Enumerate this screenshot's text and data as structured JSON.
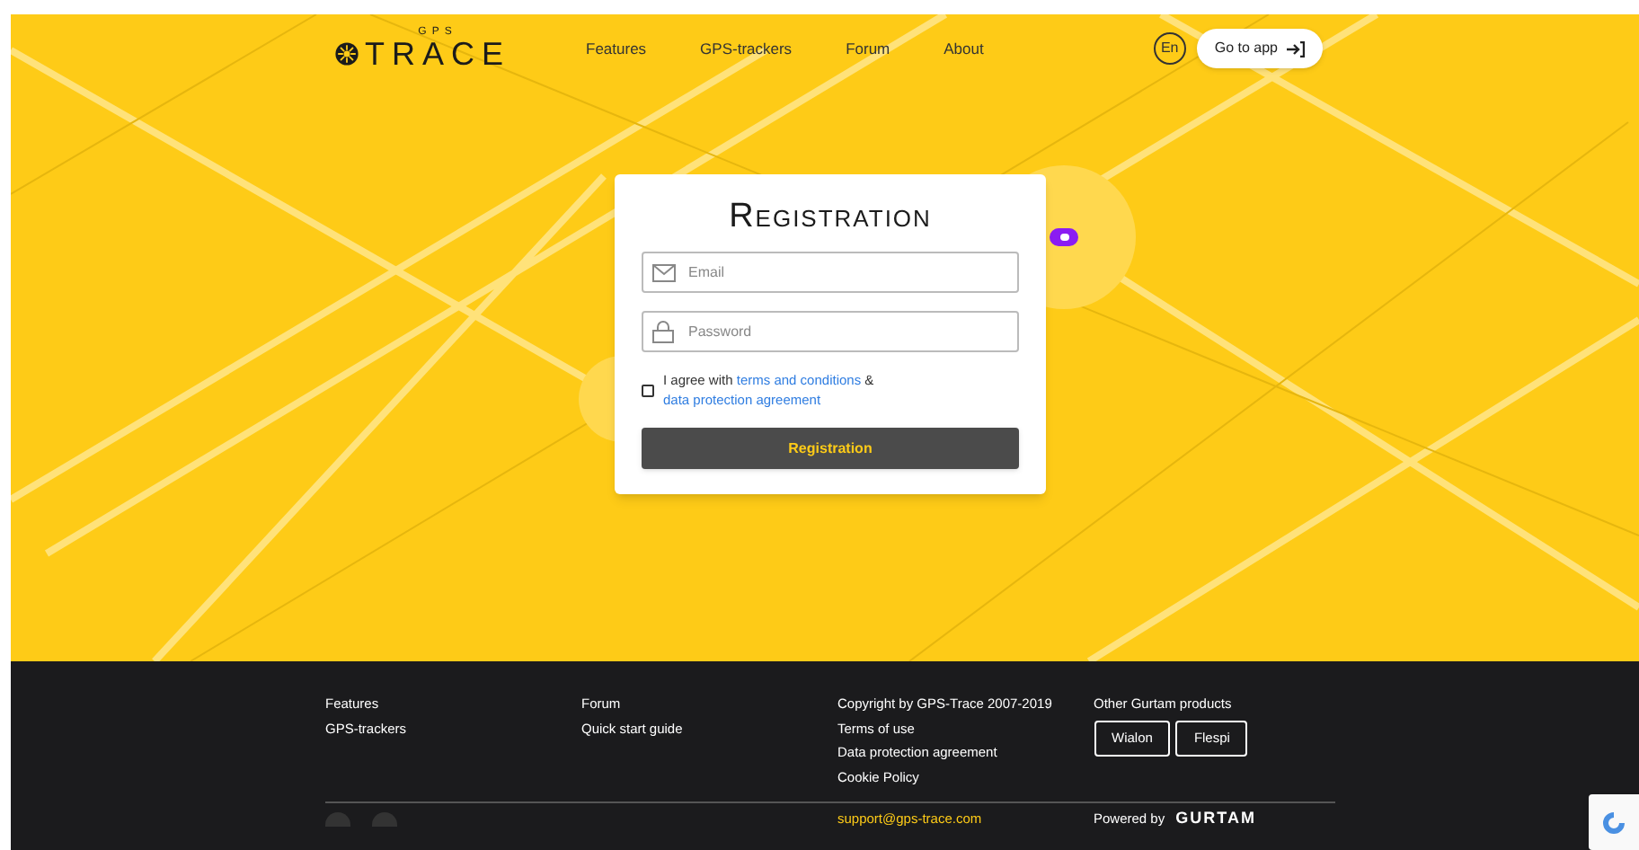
{
  "header": {
    "logo": {
      "top": "GPS",
      "main": "TRACE"
    },
    "nav": [
      "Features",
      "GPS-trackers",
      "Forum",
      "About"
    ],
    "language": "En",
    "app_button": "Go to app"
  },
  "registration": {
    "title": "Registration",
    "fields": [
      {
        "kind": "email",
        "placeholder": "Email"
      },
      {
        "kind": "password",
        "placeholder": "Password"
      }
    ],
    "agreement": {
      "checked": false,
      "prefix": "I agree with",
      "link_1": "terms and conditions",
      "middle": "&",
      "link_2": "data protection agreement"
    },
    "submit": "Registration"
  },
  "footer": {
    "columns": [
      {
        "links": [
          "Features",
          "GPS-trackers"
        ]
      },
      {
        "links": [
          "Forum",
          "Quick start guide"
        ]
      },
      {
        "links": [
          "Copyright by GPS-Trace 2007-2019",
          "Terms of use",
          "Data protection agreement",
          "Cookie Policy"
        ]
      }
    ],
    "products": {
      "title": "Other Gurtam products",
      "buttons": [
        "Wialon",
        "Flespi"
      ]
    },
    "email": "support@gps-trace.com",
    "powered_by": "Powered by",
    "company": "GURTAM"
  }
}
